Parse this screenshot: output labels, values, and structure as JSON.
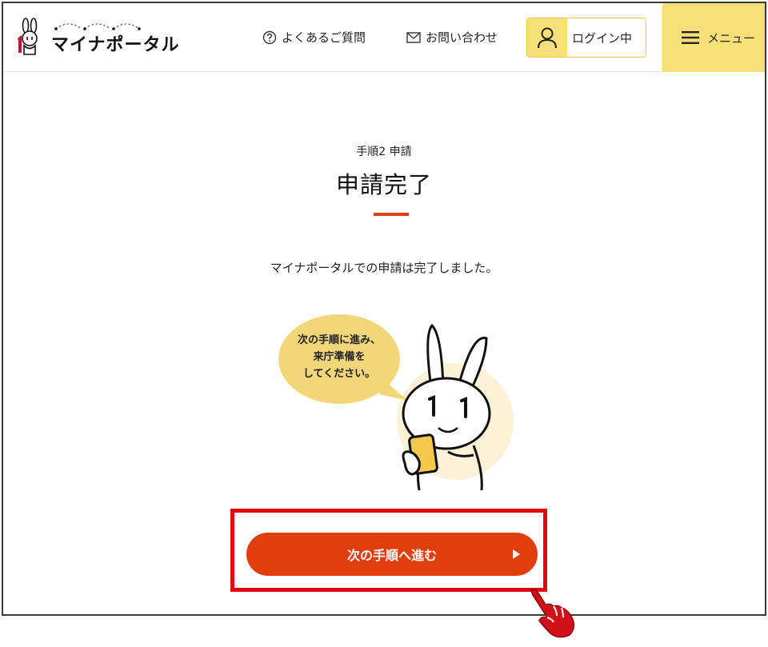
{
  "header": {
    "logo_text": "マイナポータル",
    "faq_label": "よくあるご質問",
    "contact_label": "お問い合わせ",
    "login_label": "ログイン中",
    "menu_label": "メニュー"
  },
  "main": {
    "step_label": "手順2 申請",
    "title": "申請完了",
    "message": "マイナポータルでの申請は完了しました。",
    "bubble_lines": [
      "次の手順に進み、",
      "来庁準備を",
      "してください。"
    ],
    "next_button_label": "次の手順へ進む"
  },
  "colors": {
    "accent_yellow": "#f7e07a",
    "primary_orange_red": "#e03e0d",
    "highlight_red": "#e2090f"
  }
}
